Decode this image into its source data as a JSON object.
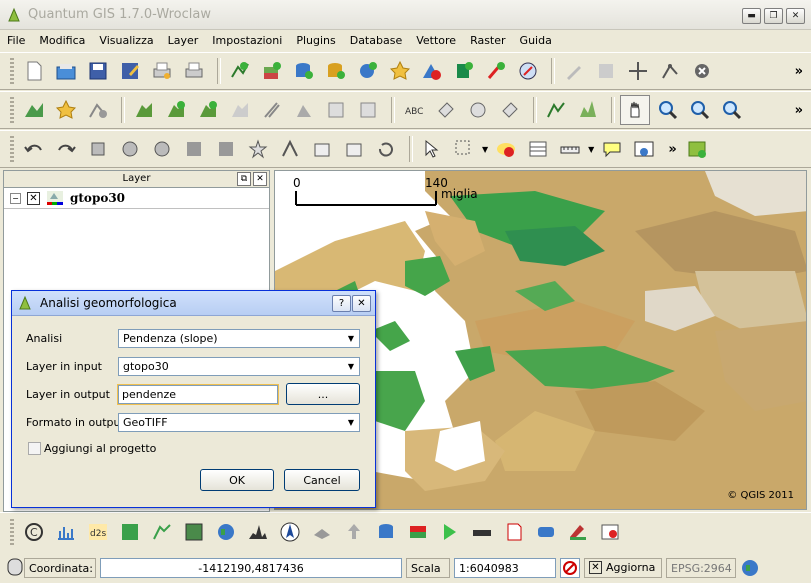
{
  "window": {
    "title": "Quantum GIS 1.7.0-Wroclaw"
  },
  "menu": [
    "File",
    "Modifica",
    "Visualizza",
    "Layer",
    "Impostazioni",
    "Plugins",
    "Database",
    "Vettore",
    "Raster",
    "Guida"
  ],
  "layers_panel": {
    "title": "Layer",
    "layers": [
      {
        "name": "gtopo30",
        "checked": true
      }
    ]
  },
  "map": {
    "scale_start": "0",
    "scale_end": "140",
    "scale_unit": "miglia",
    "copyright": "© QGIS 2011"
  },
  "dialog": {
    "title": "Analisi geomorfologica",
    "fields": {
      "analisi_label": "Analisi",
      "analisi_value": "Pendenza (slope)",
      "input_label": "Layer in input",
      "input_value": "gtopo30",
      "output_label": "Layer in output",
      "output_value": "pendenze",
      "browse_label": "...",
      "format_label": "Formato in output",
      "format_value": "GeoTIFF",
      "add_label": "Aggiungi al progetto"
    },
    "ok_label": "OK",
    "cancel_label": "Cancel"
  },
  "status": {
    "coord_label": "Coordinata:",
    "coord_value": "-1412190,4817436",
    "scale_label": "Scala",
    "scale_value": "1:6040983",
    "render_label": "Aggiorna",
    "epsg": "EPSG:2964"
  }
}
